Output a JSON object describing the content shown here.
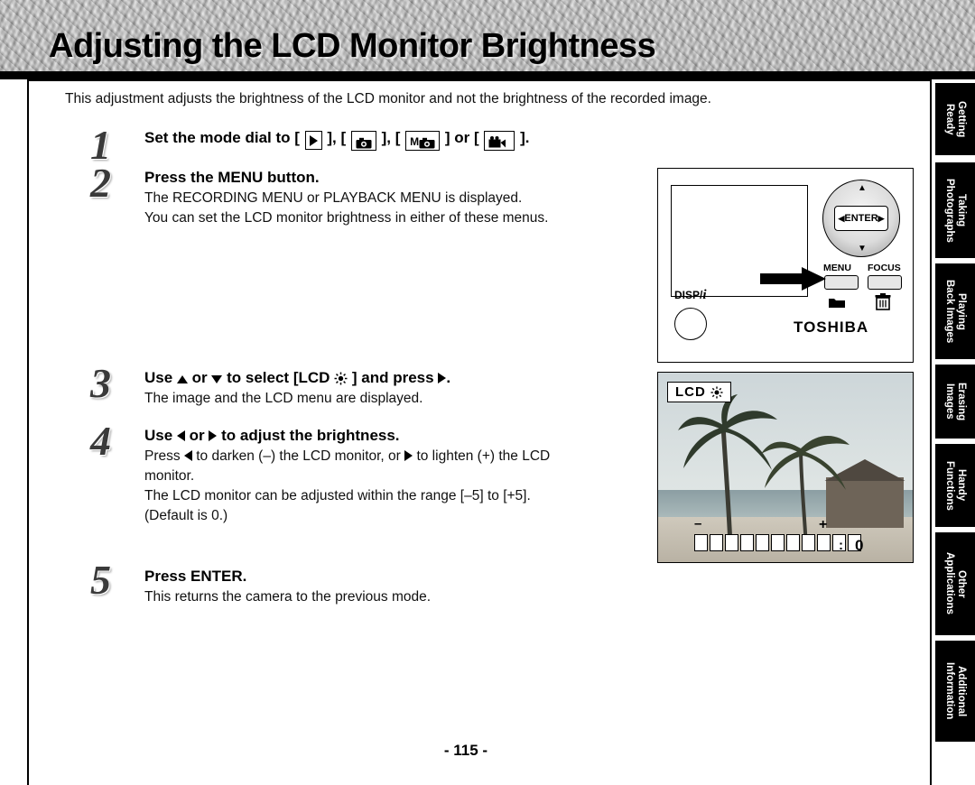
{
  "title": "Adjusting the LCD Monitor Brightness",
  "intro": "This adjustment adjusts the brightness of the LCD monitor and not the brightness of the recorded image.",
  "steps": [
    {
      "num": "1",
      "head_before": "Set the mode dial to [",
      "head_mid1": "], [",
      "head_mid2": "], [",
      "head_mid3": "] or [",
      "head_after": "].",
      "icon1": "playback-icon",
      "icon2": "camera-icon",
      "icon3": "manual-camera-icon",
      "icon4": "movie-icon",
      "body": ""
    },
    {
      "num": "2",
      "head": "Press the MENU button.",
      "body_line1": "The RECORDING MENU or PLAYBACK MENU is displayed.",
      "body_line2": "You can set the LCD monitor brightness in either of these menus."
    },
    {
      "num": "3",
      "head_a": "Use",
      "head_b": "or",
      "head_c": "to select [LCD",
      "head_d": "] and press",
      "head_e": ".",
      "body_line1": "The image and the LCD menu are displayed."
    },
    {
      "num": "4",
      "head_a": "Use",
      "head_b": "or",
      "head_c": "to adjust the brightness.",
      "body_line1a": "Press",
      "body_line1b": "to darken (–) the LCD monitor, or",
      "body_line1c": "to lighten (+) the LCD",
      "body_line2": "monitor.",
      "body_line3": "The LCD monitor can be adjusted within the range [–5] to [+5].",
      "body_line4": "(Default is 0.)"
    },
    {
      "num": "5",
      "head": "Press ENTER.",
      "body_line1": "This returns the camera to the previous mode."
    }
  ],
  "camera": {
    "enter_label": "ENTER",
    "menu_label": "MENU",
    "focus_label": "FOCUS",
    "disp_label": "DISP/",
    "disp_label_i": "i",
    "brand": "TOSHIBA",
    "up_arrow": "▲",
    "down_arrow": "▼",
    "left_arrow": "◀",
    "right_arrow": "▶",
    "folder_icon": "folder-icon",
    "trash_icon": "trash-icon"
  },
  "lcd": {
    "badge_label": "LCD",
    "badge_icon": "brightness-icon",
    "minus": "–",
    "plus": "+",
    "colon": ":",
    "value": "0",
    "bars": 11
  },
  "tabs": [
    {
      "label": "Getting\nReady"
    },
    {
      "label": "Taking\nPhotographs"
    },
    {
      "label": "Playing\nBack Images"
    },
    {
      "label": "Erasing\nImages"
    },
    {
      "label": "Handy\nFunctions"
    },
    {
      "label": "Other\nApplications"
    },
    {
      "label": "Additional\nInformation"
    }
  ],
  "page_number": "- 115 -"
}
